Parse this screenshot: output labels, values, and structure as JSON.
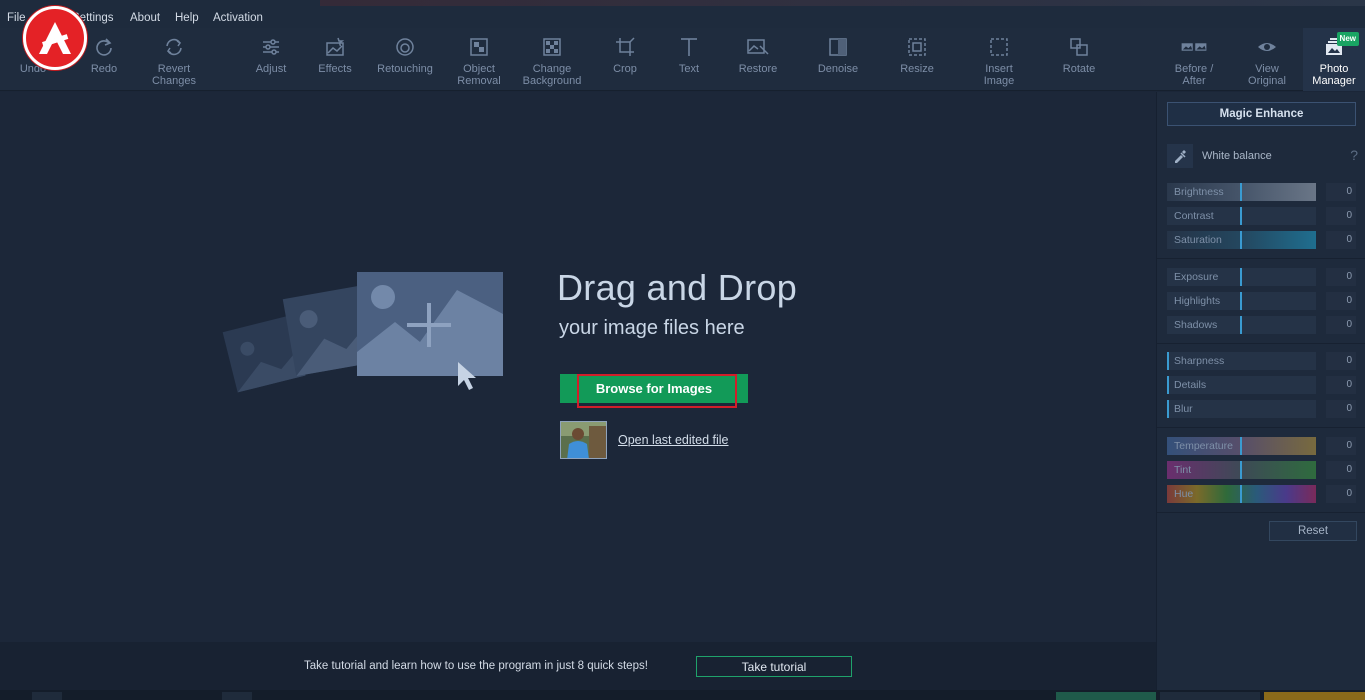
{
  "menu": {
    "file": "File",
    "settings": "Settings",
    "about": "About",
    "help": "Help",
    "activation": "Activation"
  },
  "toolbar": {
    "undo": "Undo",
    "redo": "Redo",
    "revert": "Revert\nChanges",
    "adjust": "Adjust",
    "effects": "Effects",
    "retouching": "Retouching",
    "object_removal": "Object\nRemoval",
    "change_background": "Change\nBackground",
    "crop": "Crop",
    "text": "Text",
    "restore": "Restore",
    "denoise": "Denoise",
    "resize": "Resize",
    "insert_image": "Insert\nImage",
    "rotate": "Rotate",
    "before_after": "Before /\nAfter",
    "view_original": "View\nOriginal",
    "photo_manager": "Photo\nManager",
    "new_badge": "New"
  },
  "main": {
    "title": "Drag and Drop",
    "subtitle": "your image files here",
    "browse_label": "Browse for Images",
    "open_last": "Open last edited file"
  },
  "footer": {
    "text": "Take tutorial and learn how to use the program in just 8 quick steps!",
    "tutorial_button": "Take tutorial"
  },
  "panel": {
    "magic_enhance": "Magic Enhance",
    "white_balance": "White balance",
    "help": "?",
    "sliders": {
      "brightness": {
        "label": "Brightness",
        "value": "0"
      },
      "contrast": {
        "label": "Contrast",
        "value": "0"
      },
      "saturation": {
        "label": "Saturation",
        "value": "0"
      },
      "exposure": {
        "label": "Exposure",
        "value": "0"
      },
      "highlights": {
        "label": "Highlights",
        "value": "0"
      },
      "shadows": {
        "label": "Shadows",
        "value": "0"
      },
      "sharpness": {
        "label": "Sharpness",
        "value": "0"
      },
      "details": {
        "label": "Details",
        "value": "0"
      },
      "blur": {
        "label": "Blur",
        "value": "0"
      },
      "temperature": {
        "label": "Temperature",
        "value": "0"
      },
      "tint": {
        "label": "Tint",
        "value": "0"
      },
      "hue": {
        "label": "Hue",
        "value": "0"
      }
    },
    "reset": "Reset"
  },
  "colors": {
    "accent_green": "#129a58",
    "highlight_red": "#d21e2a",
    "slider_marker": "#3a9bd1",
    "logo_red": "#e42226"
  }
}
